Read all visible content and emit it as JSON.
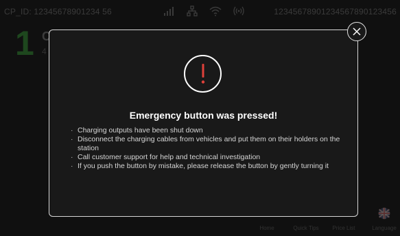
{
  "status_bar": {
    "cp_id": "CP_ID: 12345678901234 56",
    "serial": "12345678901234567890123456",
    "icons": [
      "signal-bars-icon",
      "network-icon",
      "wifi-icon",
      "rfid-icon"
    ]
  },
  "connector": {
    "number": "1",
    "title": "C",
    "subtitle": "4"
  },
  "modal": {
    "alert_icon": "exclamation-icon",
    "title": "Emergency button was pressed!",
    "bullets": [
      "Charging outputs have been shut down",
      "Disconnect the charging cables from vehicles and put them on their holders on the station",
      "Call customer support for help and technical investigation",
      "If you push the button by mistake, please release the button by gently turning it"
    ],
    "close_icon": "close-icon"
  },
  "bottom_nav": {
    "home": "Home",
    "quick_tips": "Quick Tips",
    "price_list": "Price List",
    "language": "Language"
  },
  "colors": {
    "modal_bg": "#191919",
    "modal_border": "#d8d8d8",
    "alert_red": "#e0413a",
    "connector_green": "#2f6d2f"
  }
}
